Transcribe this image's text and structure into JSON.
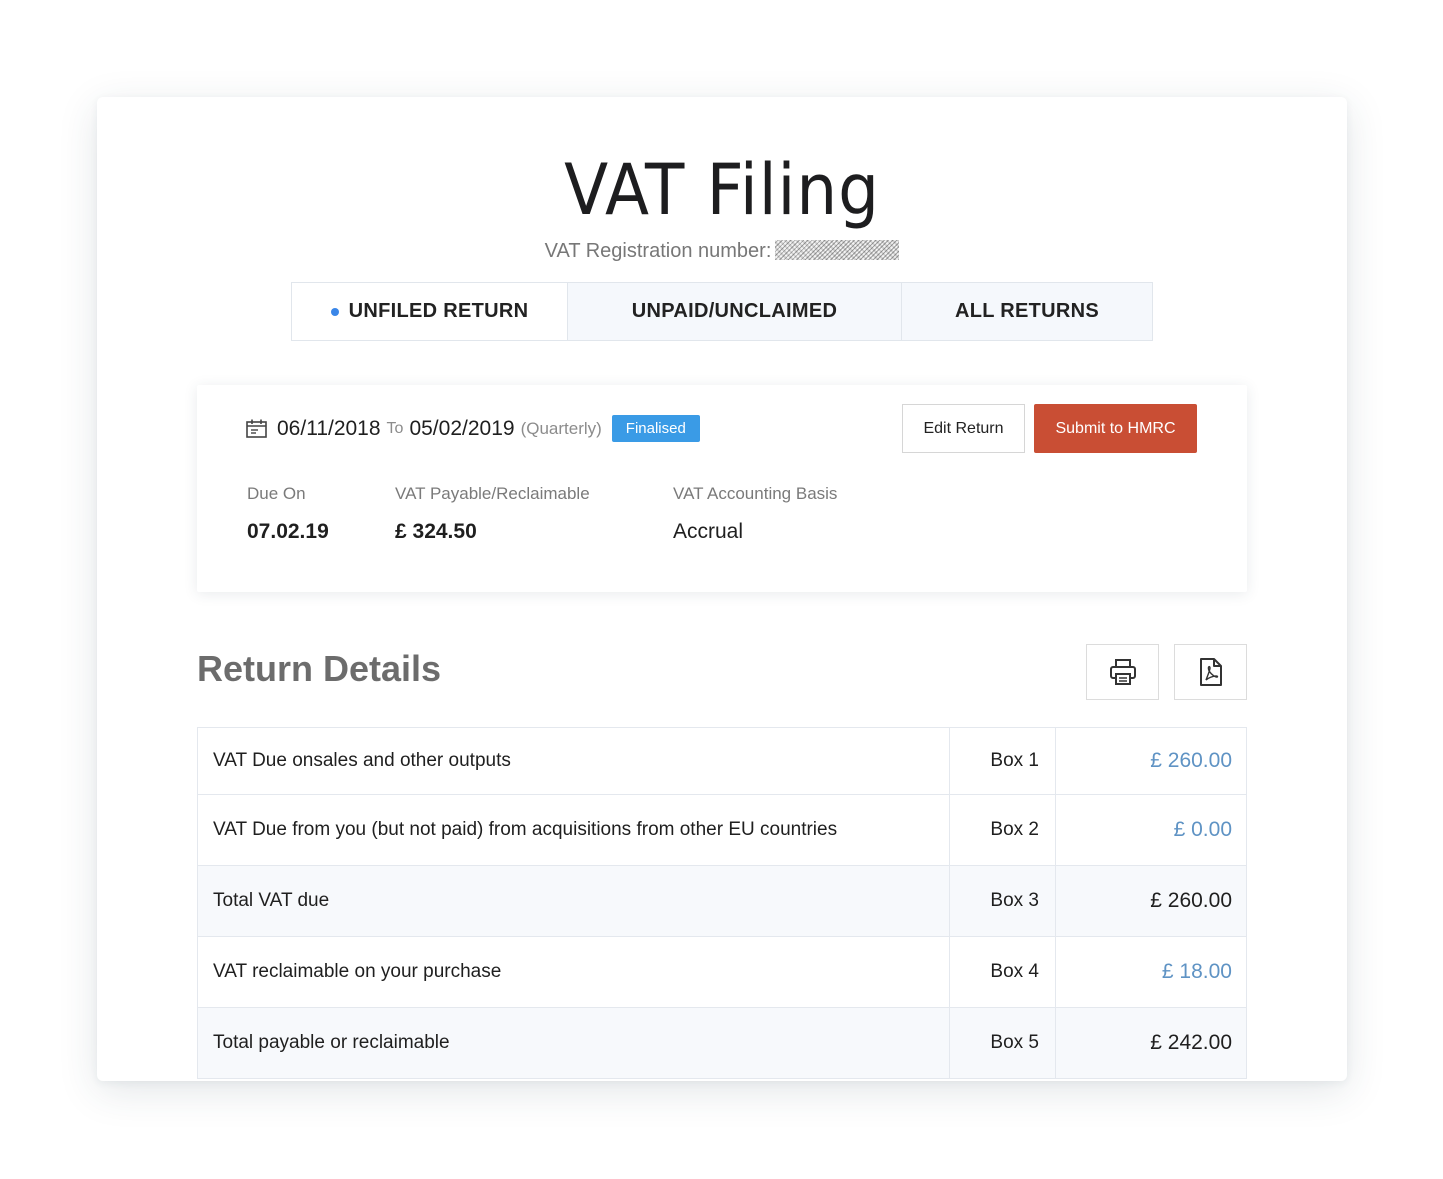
{
  "page": {
    "title": "VAT Filing",
    "registration_label": "VAT Registration number:"
  },
  "tabs": [
    {
      "label": "UNFILED RETURN",
      "active": true
    },
    {
      "label": "UNPAID/UNCLAIMED",
      "active": false
    },
    {
      "label": "ALL RETURNS",
      "active": false
    }
  ],
  "summary": {
    "period_start": "06/11/2018",
    "to_word": "To",
    "period_end": "05/02/2019",
    "frequency": "(Quarterly)",
    "status_badge": "Finalised",
    "edit_button": "Edit Return",
    "submit_button": "Submit to HMRC",
    "due_on_label": "Due On",
    "due_on_value": "07.02.19",
    "vat_payable_label": "VAT Payable/Reclaimable",
    "vat_payable_value": "£ 324.50",
    "basis_label": "VAT Accounting Basis",
    "basis_value": "Accrual"
  },
  "details": {
    "title": "Return Details",
    "rows": [
      {
        "label": "VAT Due onsales and other outputs",
        "box": "Box 1",
        "amount": "£ 260.00",
        "link": true
      },
      {
        "label": "VAT Due from you (but not paid) from acquisitions from other EU countries",
        "box": "Box 2",
        "amount": "£ 0.00",
        "link": true
      },
      {
        "label": "Total VAT due",
        "box": "Box 3",
        "amount": "£ 260.00",
        "link": false
      },
      {
        "label": "VAT reclaimable on your purchase",
        "box": "Box 4",
        "amount": "£ 18.00",
        "link": true
      },
      {
        "label": "Total payable or reclaimable",
        "box": "Box 5",
        "amount": "£ 242.00",
        "link": false
      }
    ]
  },
  "colors": {
    "accent_blue": "#3a9be6",
    "submit_red": "#c94e34",
    "link_amount": "#5f93c4"
  },
  "icons": [
    "calendar-icon",
    "print-icon",
    "pdf-icon"
  ]
}
